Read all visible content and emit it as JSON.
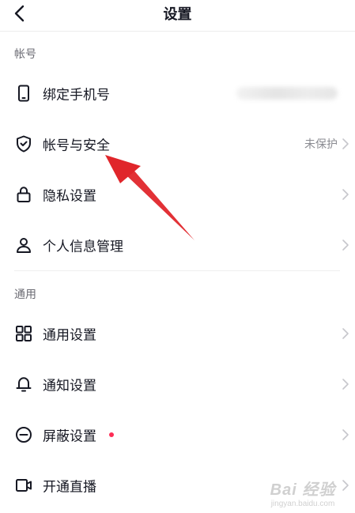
{
  "header": {
    "title": "设置"
  },
  "sections": {
    "account": {
      "label": "帐号"
    },
    "general": {
      "label": "通用"
    }
  },
  "rows": {
    "bind_phone": {
      "label": "绑定手机号"
    },
    "account_security": {
      "label": "帐号与安全",
      "value": "未保护"
    },
    "privacy": {
      "label": "隐私设置"
    },
    "personal_info": {
      "label": "个人信息管理"
    },
    "general_settings": {
      "label": "通用设置"
    },
    "notifications": {
      "label": "通知设置"
    },
    "block": {
      "label": "屏蔽设置"
    },
    "live": {
      "label": "开通直播"
    }
  },
  "icons": {
    "back": "chevron-left-icon",
    "phone": "phone-icon",
    "shield": "shield-check-icon",
    "lock": "lock-icon",
    "user": "user-icon",
    "grid": "grid-icon",
    "bell": "bell-icon",
    "block": "minus-circle-icon",
    "video": "video-camera-icon",
    "chevron": "chevron-right-icon"
  },
  "watermark": {
    "logo": "Bai 经验",
    "url": "jingyan.baidu.com"
  },
  "colors": {
    "text": "#161823",
    "secondary": "#8a8b91",
    "chevron": "#c7c7cc",
    "red_dot": "#fe2c55",
    "annotation_arrow": "#e0262b"
  }
}
